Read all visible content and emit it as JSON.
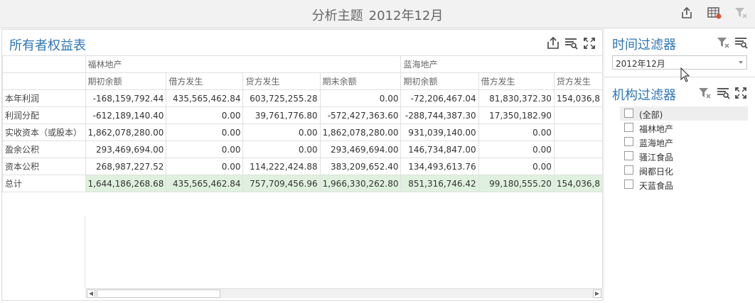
{
  "header": {
    "title": "分析主题",
    "period": "2012年12月",
    "icons": [
      "export-icon",
      "excel-icon",
      "clear-filter-icon"
    ]
  },
  "main_panel": {
    "title": "所有者权益表",
    "icons": [
      "export-icon",
      "filter-icon",
      "fullscreen-icon"
    ],
    "groups": [
      "福林地产",
      "蓝海地产"
    ],
    "columns": [
      "期初余额",
      "借方发生",
      "贷方发生",
      "期末余额",
      "期初余额",
      "借方发生",
      "贷方发生"
    ],
    "rows": [
      {
        "label": "本年利润",
        "values": [
          "-168,159,792.44",
          "435,565,462.84",
          "603,725,255.28",
          "0.00",
          "-72,206,467.04",
          "81,830,372.30",
          "154,036,8"
        ]
      },
      {
        "label": "利润分配",
        "values": [
          "-612,189,140.40",
          "0.00",
          "39,761,776.80",
          "-572,427,363.60",
          "-288,744,387.30",
          "17,350,182.90",
          ""
        ]
      },
      {
        "label": "实收资本（或股本）",
        "values": [
          "1,862,078,280.00",
          "0.00",
          "0.00",
          "1,862,078,280.00",
          "931,039,140.00",
          "0.00",
          ""
        ]
      },
      {
        "label": "盈余公积",
        "values": [
          "293,469,694.00",
          "0.00",
          "0.00",
          "293,469,694.00",
          "146,734,847.00",
          "0.00",
          ""
        ]
      },
      {
        "label": "资本公积",
        "values": [
          "268,987,227.52",
          "0.00",
          "114,222,424.88",
          "383,209,652.40",
          "134,493,613.76",
          "0.00",
          ""
        ]
      },
      {
        "label": "总计",
        "values": [
          "1,644,186,268.68",
          "435,565,462.84",
          "757,709,456.96",
          "1,966,330,262.80",
          "851,316,746.42",
          "99,180,555.20",
          "154,036,8"
        ]
      }
    ]
  },
  "time_filter": {
    "title": "时间过滤器",
    "selected": "2012年12月",
    "icons": [
      "clear-filter-icon",
      "filter-icon"
    ]
  },
  "org_filter": {
    "title": "机构过滤器",
    "icons": [
      "clear-filter-icon",
      "filter-icon",
      "fullscreen-icon"
    ],
    "items": [
      "(全部)",
      "福林地产",
      "蓝海地产",
      "骚江食品",
      "闽都日化",
      "天蓝食品"
    ]
  },
  "colors": {
    "accent": "#2e75b6",
    "total_row": "#dff0df"
  }
}
